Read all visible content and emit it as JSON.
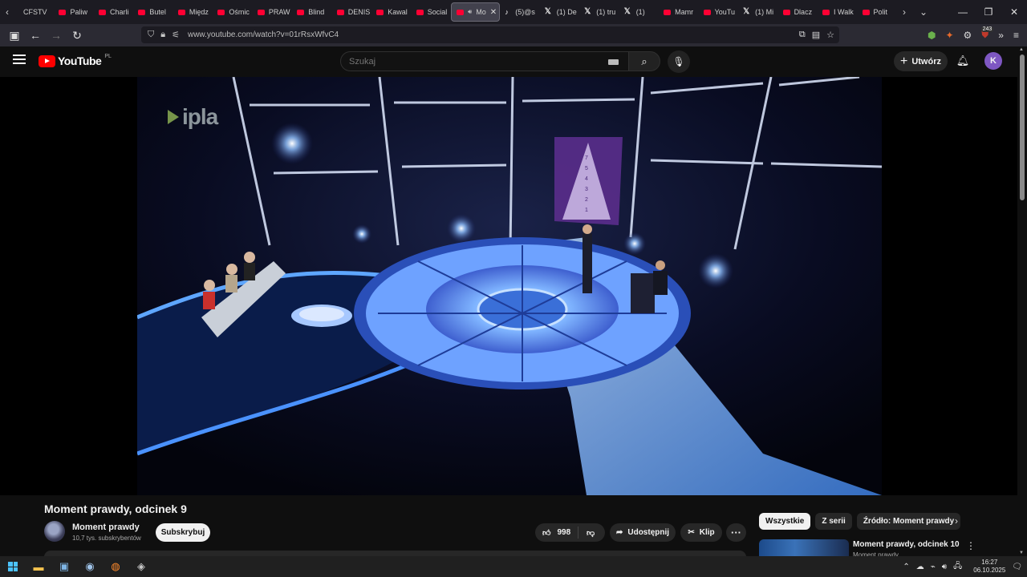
{
  "browser": {
    "tabs": [
      {
        "label": "CFSTV",
        "icon": "page-icon"
      },
      {
        "label": "Paliw",
        "icon": "youtube-icon"
      },
      {
        "label": "Charli",
        "icon": "youtube-icon"
      },
      {
        "label": "Butel",
        "icon": "youtube-icon"
      },
      {
        "label": "Międz",
        "icon": "youtube-icon"
      },
      {
        "label": "Ośmic",
        "icon": "youtube-icon"
      },
      {
        "label": "PRAW",
        "icon": "youtube-icon"
      },
      {
        "label": "Blind",
        "icon": "youtube-icon"
      },
      {
        "label": "DENIS",
        "icon": "youtube-icon"
      },
      {
        "label": "Kawal",
        "icon": "youtube-icon"
      },
      {
        "label": "Social",
        "icon": "youtube-icon"
      },
      {
        "label": "Mo",
        "icon": "youtube-icon",
        "active": true
      },
      {
        "label": "(5)@s",
        "icon": "tiktok-icon"
      },
      {
        "label": "(1) De",
        "icon": "x-icon"
      },
      {
        "label": "(1) tru",
        "icon": "x-icon"
      },
      {
        "label": "(1)",
        "icon": "x-icon"
      },
      {
        "label": "Mamr",
        "icon": "youtube-icon"
      },
      {
        "label": "YouTu",
        "icon": "youtube-icon"
      },
      {
        "label": "(1) Mi",
        "icon": "x-icon"
      },
      {
        "label": "Dlacz",
        "icon": "youtube-icon"
      },
      {
        "label": "I Walk",
        "icon": "youtube-icon"
      },
      {
        "label": "Polit",
        "icon": "youtube-icon"
      }
    ],
    "url": "www.youtube.com/watch?v=01rRsxWfvC4",
    "extension_badge": "243"
  },
  "youtube": {
    "logo_text": "YouTube",
    "region": "PL",
    "search_placeholder": "Szukaj",
    "create_label": "Utwórz",
    "avatar_letter": "K"
  },
  "video": {
    "watermark": "ipla",
    "title": "Moment prawdy, odcinek 9",
    "channel_name": "Moment prawdy",
    "subscribers": "10,7 tys. subskrybentów",
    "subscribe_label": "Subskrybuj",
    "likes": "998",
    "share_label": "Udostępnij",
    "clip_label": "Klip"
  },
  "sidebar": {
    "chips": [
      "Wszystkie",
      "Z serii",
      "Źródło: Moment prawdy"
    ],
    "recommendation": {
      "title": "Moment prawdy, odcinek 10",
      "channel": "Moment prawdy"
    }
  },
  "taskbar": {
    "time": "16:27",
    "date": "06.10.2025"
  },
  "colors": {
    "youtube_red": "#ff0000",
    "avatar_purple": "#7e57c2",
    "background": "#0f0f0f"
  }
}
